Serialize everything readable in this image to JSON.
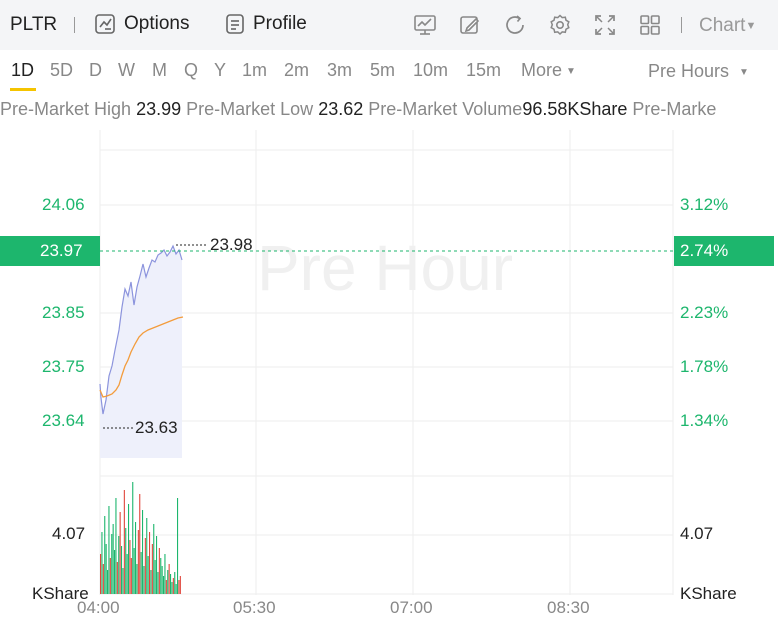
{
  "header": {
    "ticker": "PLTR",
    "options_label": "Options",
    "profile_label": "Profile",
    "chart_dropdown": "Chart"
  },
  "toolbar_icons": [
    "indicator-icon",
    "draw-icon",
    "refresh-icon",
    "settings-icon",
    "fullscreen-icon",
    "layout-icon"
  ],
  "periods": [
    "1D",
    "5D",
    "D",
    "W",
    "M",
    "Q",
    "Y",
    "1m",
    "2m",
    "3m",
    "5m",
    "10m",
    "15m",
    "More"
  ],
  "active_period": "1D",
  "session_select": "Pre Hours",
  "stats": {
    "high_label": "Pre-Market High",
    "high_value": "23.99",
    "low_label": "Pre-Market Low",
    "low_value": "23.62",
    "volume_label": "Pre-Market Volume",
    "volume_value": "96.58KShare",
    "trailing": "Pre-Marke"
  },
  "watermark": "Pre Hour",
  "axis": {
    "price_ticks": [
      "24.06",
      "23.85",
      "23.75",
      "23.64"
    ],
    "pct_ticks": [
      "3.12%",
      "2.23%",
      "1.78%",
      "1.34%"
    ],
    "current_price": "23.97",
    "current_pct": "2.74%",
    "high_marker": "23.98",
    "low_marker": "23.63",
    "volume_tick": "4.07",
    "volume_unit": "KShare",
    "time_ticks": [
      "04:00",
      "05:30",
      "07:00",
      "08:30"
    ]
  },
  "colors": {
    "up": "#1db66d",
    "down": "#e0463c",
    "price_line": "#8c94dd",
    "avg_line": "#f39c3c",
    "accent": "#f5c400"
  }
}
